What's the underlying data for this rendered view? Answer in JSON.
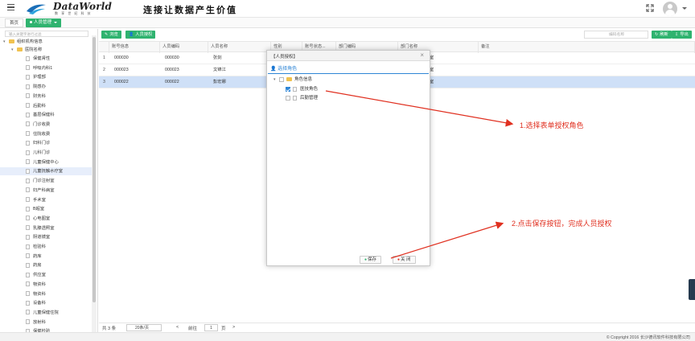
{
  "header": {
    "logo_title": "DataWorld",
    "logo_sub": "数 享 世 纪 科 技",
    "slogan": "连接让数据产生价值"
  },
  "tabs": [
    {
      "label": "首页"
    },
    {
      "label": "人员管理"
    }
  ],
  "sidebar": {
    "search_placeholder": "输入关键字进行过滤",
    "root": "组织机构信息",
    "hospital": "医院名称",
    "items": [
      "保健肾性",
      "呼吸内科1",
      "护理部",
      "院感办",
      "财务科",
      "后勤科",
      "基层保健科",
      "门诊收费",
      "住院收费",
      "妇科门诊",
      "儿科门诊",
      "儿童保健中心",
      "儿童抚触水疗室",
      "门诊注射室",
      "妇产科病室",
      "手术室",
      "B超室",
      "心电图室",
      "乳腺透照室",
      "阴道镜室",
      "检验科",
      "药库",
      "药房",
      "供应室",
      "物资科",
      "物资科",
      "设备科",
      "儿童保健住院",
      "放射科",
      "保健检验"
    ],
    "selected_index": 12
  },
  "toolbar": {
    "browse_label": "浏览",
    "authorize_label": "人员授权",
    "search_placeholder": "编码名称",
    "refresh_label": "刷新",
    "export_label": "导出"
  },
  "grid": {
    "columns": [
      "账号信息",
      "人员编码",
      "人员名称",
      "性别",
      "账号状态...",
      "部门编码",
      "部门名称",
      "备注"
    ],
    "rows": [
      {
        "num": "1",
        "account": "000030",
        "code": "000030",
        "name": "张剑",
        "dept": "室"
      },
      {
        "num": "2",
        "account": "000023",
        "code": "000023",
        "name": "文锦江",
        "dept": "室"
      },
      {
        "num": "3",
        "account": "000022",
        "code": "000022",
        "name": "彭宏娜",
        "dept": "室"
      }
    ],
    "selected_row": 2
  },
  "pager": {
    "total": "共 3 条",
    "page_size": "20条/页",
    "prev": "<",
    "goto": "前往",
    "page": "1",
    "page_unit": "页",
    "next": ">"
  },
  "footer": {
    "copyright": "© Copyright 2016 长沙德讯软件科技有限公司"
  },
  "modal": {
    "title": "【人员授权】",
    "close": "×",
    "tab": "选择角色",
    "tree_root": "角色信息",
    "roles": [
      {
        "label": "医技角色",
        "checked": true
      },
      {
        "label": "后勤管理",
        "checked": false
      }
    ],
    "save_label": "保存",
    "close_label": "关 闭"
  },
  "annotations": {
    "step1": "1.选择表单授权角色",
    "step2": "2.点击保存按钮，完成人员授权"
  },
  "colors": {
    "accent_green": "#2fb36f",
    "accent_blue": "#2f86d6",
    "annotation_red": "#e03020"
  }
}
